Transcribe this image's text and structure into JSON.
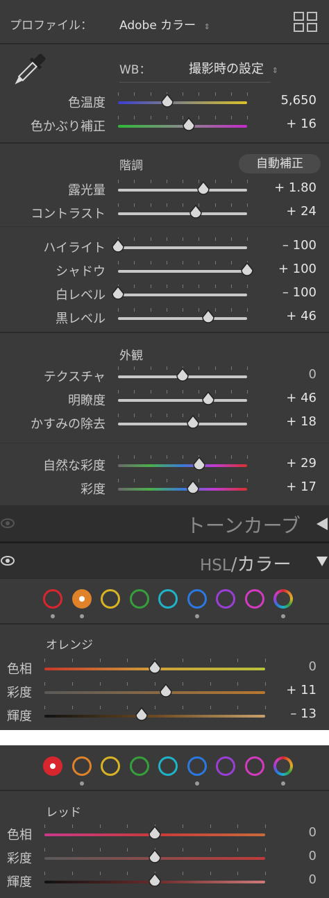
{
  "profile": {
    "label": "プロファイル：",
    "value": "Adobe カラー"
  },
  "wb": {
    "label": "WB：",
    "value": "撮影時の設定"
  },
  "basic_sliders": [
    {
      "id": "temp",
      "label": "色温度",
      "value": "5,650",
      "pos": 0.38
    },
    {
      "id": "tint",
      "label": "色かぶり補正",
      "value": "+ 16",
      "pos": 0.55
    }
  ],
  "tone": {
    "title": "階調",
    "auto_button": "自動補正",
    "sliders": [
      {
        "id": "exposure",
        "label": "露光量",
        "value": "+ 1.80",
        "pos": 0.66
      },
      {
        "id": "contrast",
        "label": "コントラスト",
        "value": "+ 24",
        "pos": 0.6
      }
    ]
  },
  "tone2": {
    "sliders": [
      {
        "id": "highlights",
        "label": "ハイライト",
        "value": "– 100",
        "pos": 0.0
      },
      {
        "id": "shadows",
        "label": "シャドウ",
        "value": "+ 100",
        "pos": 1.0
      },
      {
        "id": "whites",
        "label": "白レベル",
        "value": "– 100",
        "pos": 0.0
      },
      {
        "id": "blacks",
        "label": "黒レベル",
        "value": "+ 46",
        "pos": 0.7
      }
    ]
  },
  "presence": {
    "title": "外観",
    "sliders": [
      {
        "id": "texture",
        "label": "テクスチャ",
        "value": "0",
        "pos": 0.5
      },
      {
        "id": "clarity",
        "label": "明瞭度",
        "value": "+ 46",
        "pos": 0.7
      },
      {
        "id": "dehaze",
        "label": "かすみの除去",
        "value": "+ 18",
        "pos": 0.58
      }
    ]
  },
  "saturation": {
    "sliders": [
      {
        "id": "vibrance",
        "label": "自然な彩度",
        "value": "+ 29",
        "pos": 0.63
      },
      {
        "id": "saturation",
        "label": "彩度",
        "value": "+ 17",
        "pos": 0.58
      }
    ]
  },
  "tone_curve": {
    "title": "トーンカーブ"
  },
  "hsl": {
    "title_a": "HSL",
    "title_sep": "/",
    "title_b": "カラー"
  },
  "color_swatches": [
    {
      "name": "red",
      "color": "#d8262e"
    },
    {
      "name": "orange",
      "color": "#e0822a"
    },
    {
      "name": "yellow",
      "color": "#d9b326"
    },
    {
      "name": "green",
      "color": "#35a03b"
    },
    {
      "name": "aqua",
      "color": "#1fb3c8"
    },
    {
      "name": "blue",
      "color": "#2a78e0"
    },
    {
      "name": "purple",
      "color": "#9a3fd6"
    },
    {
      "name": "magenta",
      "color": "#d43ac0"
    },
    {
      "name": "all",
      "color": "#ffffff"
    }
  ],
  "orange_panel": {
    "title": "オレンジ",
    "selected_index": 1,
    "sliders": [
      {
        "id": "o-hue",
        "label": "色相",
        "value": "0",
        "pos": 0.5
      },
      {
        "id": "o-sat",
        "label": "彩度",
        "value": "+ 11",
        "pos": 0.55
      },
      {
        "id": "o-lum",
        "label": "輝度",
        "value": "– 13",
        "pos": 0.44
      }
    ]
  },
  "red_panel": {
    "title": "レッド",
    "selected_index": 0,
    "sliders": [
      {
        "id": "r-hue",
        "label": "色相",
        "value": "0",
        "pos": 0.5
      },
      {
        "id": "r-sat",
        "label": "彩度",
        "value": "0",
        "pos": 0.5
      },
      {
        "id": "r-lum",
        "label": "輝度",
        "value": "0",
        "pos": 0.5
      }
    ]
  }
}
